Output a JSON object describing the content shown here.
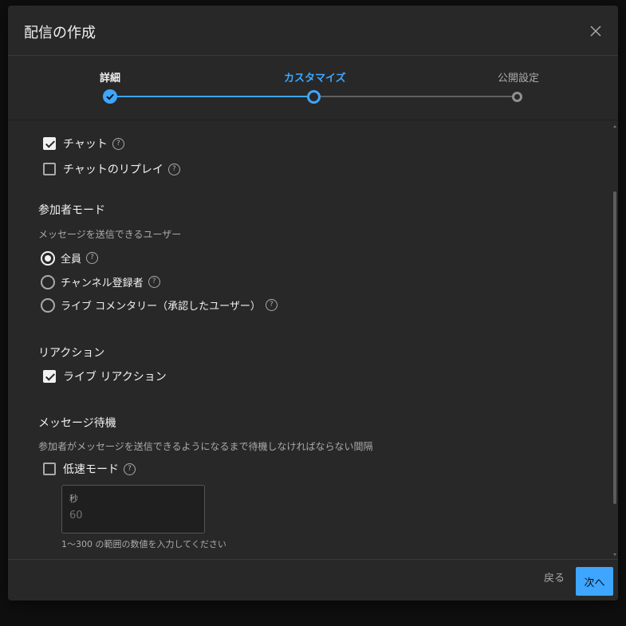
{
  "dialog": {
    "title": "配信の作成"
  },
  "steps": [
    {
      "label": "詳細"
    },
    {
      "label": "カスタマイズ"
    },
    {
      "label": "公開設定"
    }
  ],
  "chat": {
    "chat_label": "チャット",
    "replay_label": "チャットのリプレイ"
  },
  "participant_mode": {
    "title": "参加者モード",
    "description": "メッセージを送信できるユーザー",
    "options": [
      {
        "label": "全員"
      },
      {
        "label": "チャンネル登録者"
      },
      {
        "label": "ライブ コメンタリー（承認したユーザー）"
      }
    ]
  },
  "reactions": {
    "title": "リアクション",
    "live_reactions_label": "ライブ リアクション"
  },
  "message_delay": {
    "title": "メッセージ待機",
    "description": "参加者がメッセージを送信できるようになるまで待機しなければならない間隔",
    "slow_mode_label": "低速モード",
    "seconds_caption": "秒",
    "seconds_placeholder": "60",
    "hint": "1〜300 の範囲の数値を入力してください"
  },
  "footer": {
    "back_label": "戻る",
    "next_label": "次へ"
  },
  "colors": {
    "accent": "#3ea6ff",
    "background": "#282828"
  }
}
